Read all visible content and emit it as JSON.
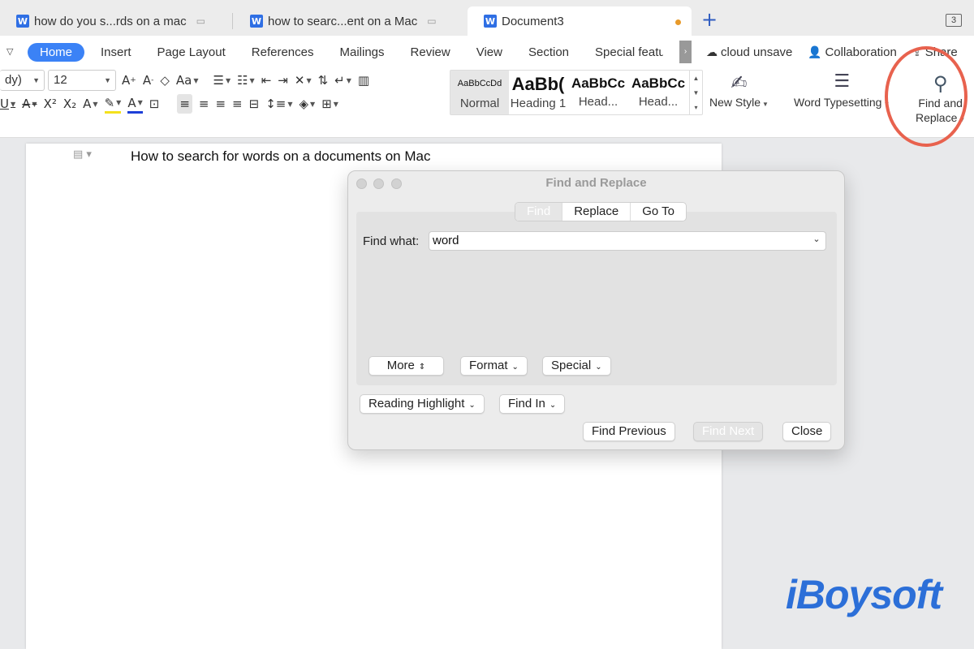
{
  "tabs": [
    {
      "label": "how do you s...rds on a mac"
    },
    {
      "label": "how to searc...ent on a Mac"
    },
    {
      "label": "Document3"
    }
  ],
  "tab_count": "3",
  "menu": {
    "items": [
      "Home",
      "Insert",
      "Page Layout",
      "References",
      "Mailings",
      "Review",
      "View",
      "Section",
      "Special feature"
    ],
    "cloud": "cloud unsave",
    "collaboration": "Collaboration",
    "share": "Share"
  },
  "font": {
    "name": "dy)",
    "size": "12"
  },
  "styles": [
    {
      "sample": "AaBbCcDd",
      "name": "Normal"
    },
    {
      "sample": "AaBb(",
      "name": "Heading 1"
    },
    {
      "sample": "AaBbCc",
      "name": "Head..."
    },
    {
      "sample": "AaBbCc",
      "name": "Head..."
    }
  ],
  "tools": {
    "new_style": "New Style",
    "word_typesetting": "Word Typesetting",
    "find_replace_1": "Find and",
    "find_replace_2": "Replace"
  },
  "document": {
    "text": "How to search for words on a documents on Mac"
  },
  "dialog": {
    "title": "Find and Replace",
    "tabs": [
      "Find",
      "Replace",
      "Go To"
    ],
    "find_what_label": "Find what:",
    "find_what_value": "word",
    "more": "More",
    "format": "Format",
    "special": "Special",
    "reading_highlight": "Reading Highlight",
    "find_in": "Find In",
    "find_previous": "Find Previous",
    "find_next": "Find Next",
    "close": "Close"
  },
  "watermark": "iBoysoft",
  "colors": {
    "accent": "#3b82f6",
    "highlight_circle": "#e8624e",
    "modified_dot": "#e89a2a"
  }
}
